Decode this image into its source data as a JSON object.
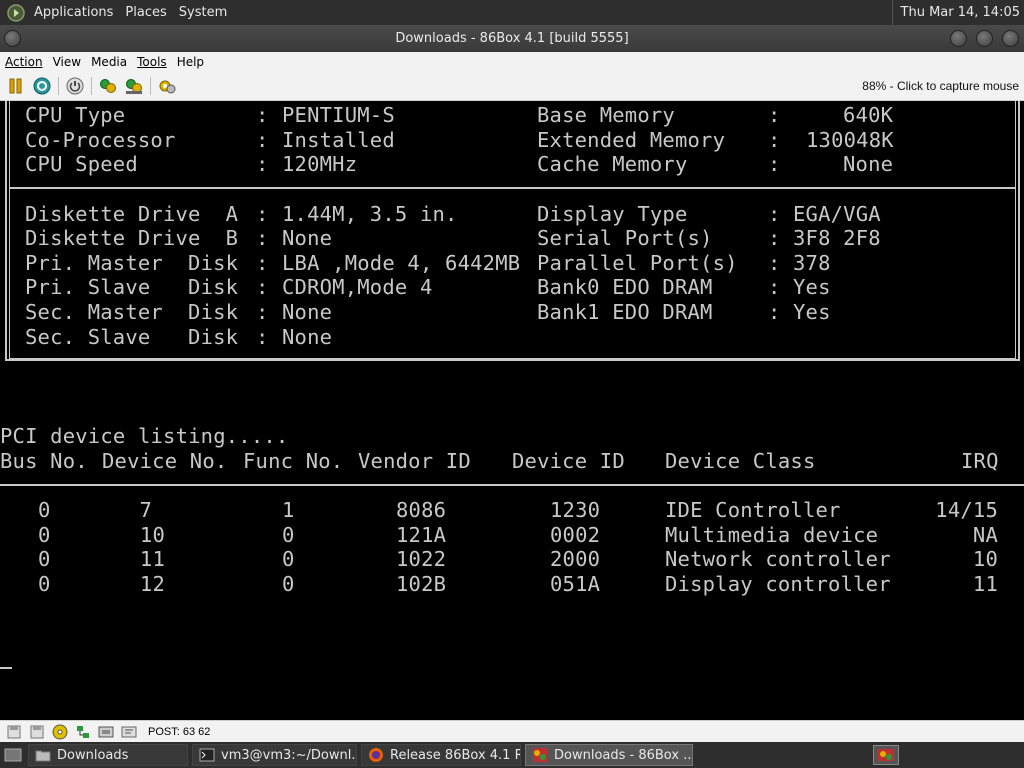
{
  "panel": {
    "applications": "Applications",
    "places": "Places",
    "system": "System",
    "clock": "Thu Mar 14, 14:05"
  },
  "window": {
    "title": "Downloads - 86Box 4.1 [build 5555]"
  },
  "menu": {
    "action": "Action",
    "view": "View",
    "media": "Media",
    "tools": "Tools",
    "help": "Help"
  },
  "toolbar": {
    "capture_status": "88% - Click to capture mouse"
  },
  "bios": {
    "cpu_type_label": "CPU Type",
    "cpu_type": "PENTIUM-S",
    "coproc_label": "Co-Processor",
    "coproc": "Installed",
    "cpu_speed_label": "CPU Speed",
    "cpu_speed": "120MHz",
    "base_mem_label": "Base Memory",
    "base_mem": "640K",
    "ext_mem_label": "Extended Memory",
    "ext_mem": "130048K",
    "cache_mem_label": "Cache Memory",
    "cache_mem": "None",
    "drive_a_label": "Diskette Drive  A",
    "drive_a": "1.44M, 3.5 in.",
    "drive_b_label": "Diskette Drive  B",
    "drive_b": "None",
    "pri_master_label": "Pri. Master  Disk",
    "pri_master": "LBA ,Mode 4, 6442MB",
    "pri_slave_label": "Pri. Slave   Disk",
    "pri_slave": "CDROM,Mode 4",
    "sec_master_label": "Sec. Master  Disk",
    "sec_master": "None",
    "sec_slave_label": "Sec. Slave   Disk",
    "sec_slave": "None",
    "display_label": "Display Type",
    "display": "EGA/VGA",
    "serial_label": "Serial Port(s)",
    "serial": "3F8 2F8",
    "parallel_label": "Parallel Port(s)",
    "parallel": "378",
    "bank0_label": "Bank0 EDO DRAM",
    "bank0": "Yes",
    "bank1_label": "Bank1 EDO DRAM",
    "bank1": "Yes"
  },
  "pci": {
    "heading": "PCI device listing.....",
    "columns": [
      "Bus No.",
      "Device No.",
      "Func No.",
      "Vendor ID",
      "Device ID",
      "Device Class",
      "IRQ"
    ],
    "rows": [
      {
        "bus": "0",
        "dev": "7",
        "func": "1",
        "vendor": "8086",
        "device": "1230",
        "cls": "IDE Controller",
        "irq": "14/15"
      },
      {
        "bus": "0",
        "dev": "10",
        "func": "0",
        "vendor": "121A",
        "device": "0002",
        "cls": "Multimedia device",
        "irq": "NA"
      },
      {
        "bus": "0",
        "dev": "11",
        "func": "0",
        "vendor": "1022",
        "device": "2000",
        "cls": "Network controller",
        "irq": "10"
      },
      {
        "bus": "0",
        "dev": "12",
        "func": "0",
        "vendor": "102B",
        "device": "051A",
        "cls": "Display controller",
        "irq": "11"
      }
    ]
  },
  "status": {
    "post": "POST: 63 62"
  },
  "taskbar": {
    "downloads": "Downloads",
    "terminal": "vm3@vm3:~/Downl...",
    "firefox": "Release 86Box 4.1 R...",
    "emu": "Downloads - 86Box ..."
  }
}
